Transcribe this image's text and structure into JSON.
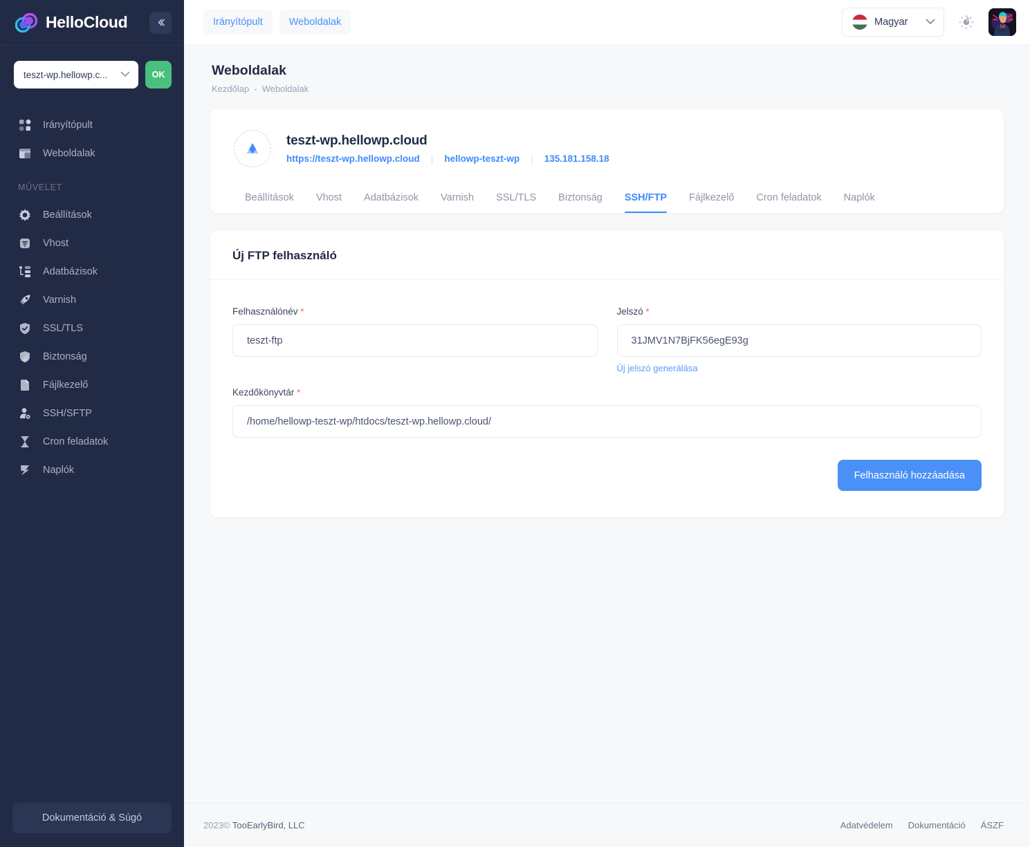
{
  "brand": {
    "name": "HelloCloud",
    "collapse_icon": "chevron-left"
  },
  "sidebar": {
    "site_selector": {
      "value": "teszt-wp.hellowp.c...",
      "ok_label": "OK"
    },
    "primary": [
      {
        "label": "Irányítópult",
        "icon": "dashboard-icon"
      },
      {
        "label": "Weboldalak",
        "icon": "sites-icon"
      }
    ],
    "section_label": "MŰVELET",
    "actions": [
      {
        "label": "Beállítások",
        "icon": "gear-icon"
      },
      {
        "label": "Vhost",
        "icon": "vhost-icon"
      },
      {
        "label": "Adatbázisok",
        "icon": "database-icon"
      },
      {
        "label": "Varnish",
        "icon": "rocket-icon"
      },
      {
        "label": "SSL/TLS",
        "icon": "shield-check-icon"
      },
      {
        "label": "Biztonság",
        "icon": "security-icon"
      },
      {
        "label": "Fájlkezelő",
        "icon": "file-icon"
      },
      {
        "label": "SSH/SFTP",
        "icon": "user-key-icon"
      },
      {
        "label": "Cron feladatok",
        "icon": "hourglass-icon"
      },
      {
        "label": "Naplók",
        "icon": "logs-icon"
      }
    ],
    "footer_button": "Dokumentáció & Súgó"
  },
  "topbar": {
    "crumbs": [
      {
        "label": "Irányítópult"
      },
      {
        "label": "Weboldalak"
      }
    ],
    "language": {
      "value": "Magyar",
      "flag": "hungary-flag-icon"
    },
    "theme_toggle_icon": "sun-icon",
    "avatar_icon": "user-avatar"
  },
  "page": {
    "title": "Weboldalak",
    "breadcrumb": [
      "Kezdőlap",
      "Weboldalak"
    ],
    "breadcrumb_separator": "-"
  },
  "site": {
    "icon": "site-triangle-icon",
    "name": "teszt-wp.hellowp.cloud",
    "url": "https://teszt-wp.hellowp.cloud",
    "system_user": "hellowp-teszt-wp",
    "ip": "135.181.158.18",
    "separator": "|"
  },
  "tabs": [
    {
      "label": "Beállítások",
      "active": false
    },
    {
      "label": "Vhost",
      "active": false
    },
    {
      "label": "Adatbázisok",
      "active": false
    },
    {
      "label": "Varnish",
      "active": false
    },
    {
      "label": "SSL/TLS",
      "active": false
    },
    {
      "label": "Biztonság",
      "active": false
    },
    {
      "label": "SSH/FTP",
      "active": true
    },
    {
      "label": "Fájlkezelő",
      "active": false
    },
    {
      "label": "Cron feladatok",
      "active": false
    },
    {
      "label": "Naplók",
      "active": false
    }
  ],
  "form": {
    "title": "Új FTP felhasználó",
    "username": {
      "label": "Felhasználónév",
      "required_mark": "*",
      "value": "teszt-ftp"
    },
    "password": {
      "label": "Jelszó",
      "required_mark": "*",
      "value": "31JMV1N7BjFK56egE93g",
      "generate_link": "Új jelszó generálása"
    },
    "home_dir": {
      "label": "Kezdőkönyvtár",
      "required_mark": "*",
      "value": "/home/hellowp-teszt-wp/htdocs/teszt-wp.hellowp.cloud/"
    },
    "submit_label": "Felhasználó hozzáadása"
  },
  "footer": {
    "copyright_year": "2023©",
    "company": "TooEarlyBird, LLC",
    "links": [
      "Adatvédelem",
      "Dokumentáció",
      "ÁSZF"
    ]
  },
  "colors": {
    "sidebar_bg": "#222b45",
    "accent_blue": "#3d8bfd",
    "button_blue": "#4a90f7",
    "ok_green": "#4ac07e",
    "required_red": "#ff4d6a",
    "page_bg": "#f7f8fa"
  }
}
